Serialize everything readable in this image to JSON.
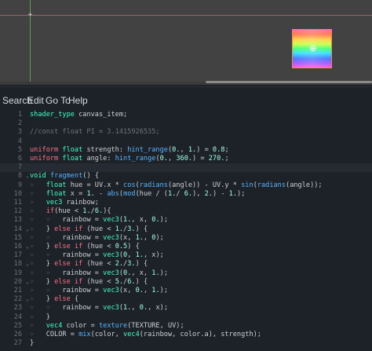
{
  "menu": [
    "Search",
    "Edit",
    "Go To",
    "Help"
  ],
  "viewport": {
    "pivot_glyph": "⊕",
    "origin_glyph": "+"
  },
  "editor": {
    "current_line": 7,
    "lines": [
      {
        "n": "1",
        "fold": "",
        "indent": 0,
        "tokens": [
          [
            "ty",
            "shader_type"
          ],
          [
            "nm",
            " canvas_item;"
          ]
        ]
      },
      {
        "n": "2",
        "fold": "",
        "indent": 0,
        "tokens": []
      },
      {
        "n": "3",
        "fold": "",
        "indent": 0,
        "tokens": [
          [
            "cm",
            "//const float PI = 3.1415926535;"
          ]
        ]
      },
      {
        "n": "4",
        "fold": "",
        "indent": 0,
        "tokens": []
      },
      {
        "n": "5",
        "fold": "",
        "indent": 0,
        "tokens": [
          [
            "kw",
            "uniform"
          ],
          [
            "nm",
            " "
          ],
          [
            "ty",
            "float"
          ],
          [
            "nm",
            " strength: "
          ],
          [
            "fn",
            "hint_range"
          ],
          [
            "nm",
            "("
          ],
          [
            "num",
            "0."
          ],
          [
            "nm",
            ", "
          ],
          [
            "num",
            "1."
          ],
          [
            "nm",
            ") = "
          ],
          [
            "num",
            "0.8"
          ],
          [
            "nm",
            ";"
          ]
        ]
      },
      {
        "n": "6",
        "fold": "",
        "indent": 0,
        "tokens": [
          [
            "kw",
            "uniform"
          ],
          [
            "nm",
            " "
          ],
          [
            "ty",
            "float"
          ],
          [
            "nm",
            " angle: "
          ],
          [
            "fn",
            "hint_range"
          ],
          [
            "nm",
            "("
          ],
          [
            "num",
            "0."
          ],
          [
            "nm",
            ", "
          ],
          [
            "num",
            "360."
          ],
          [
            "nm",
            ") = "
          ],
          [
            "num",
            "270."
          ],
          [
            "nm",
            ";"
          ]
        ]
      },
      {
        "n": "7",
        "fold": "",
        "indent": 0,
        "tokens": []
      },
      {
        "n": "8",
        "fold": "⌄",
        "indent": 0,
        "tokens": [
          [
            "ty",
            "void"
          ],
          [
            "nm",
            " "
          ],
          [
            "fn",
            "fragment"
          ],
          [
            "nm",
            "() {"
          ]
        ]
      },
      {
        "n": "9",
        "fold": "",
        "indent": 1,
        "tokens": [
          [
            "ty",
            "float"
          ],
          [
            "nm",
            " hue = UV.x * "
          ],
          [
            "fn",
            "cos"
          ],
          [
            "nm",
            "("
          ],
          [
            "fn",
            "radians"
          ],
          [
            "nm",
            "(angle)) - UV.y * "
          ],
          [
            "fn",
            "sin"
          ],
          [
            "nm",
            "("
          ],
          [
            "fn",
            "radians"
          ],
          [
            "nm",
            "(angle));"
          ]
        ]
      },
      {
        "n": "10",
        "fold": "",
        "indent": 1,
        "tokens": [
          [
            "ty",
            "float"
          ],
          [
            "nm",
            " x = "
          ],
          [
            "num",
            "1."
          ],
          [
            "nm",
            " - "
          ],
          [
            "fn",
            "abs"
          ],
          [
            "nm",
            "("
          ],
          [
            "fn",
            "mod"
          ],
          [
            "nm",
            "(hue / ("
          ],
          [
            "num",
            "1."
          ],
          [
            "nm",
            "/ "
          ],
          [
            "num",
            "6."
          ],
          [
            "nm",
            "), "
          ],
          [
            "num",
            "2."
          ],
          [
            "nm",
            ") - "
          ],
          [
            "num",
            "1."
          ],
          [
            "nm",
            ");"
          ]
        ]
      },
      {
        "n": "11",
        "fold": "",
        "indent": 1,
        "tokens": [
          [
            "ty",
            "vec3"
          ],
          [
            "nm",
            " rainbow;"
          ]
        ]
      },
      {
        "n": "12",
        "fold": "",
        "indent": 1,
        "tokens": [
          [
            "kw",
            "if"
          ],
          [
            "nm",
            "(hue < "
          ],
          [
            "num",
            "1."
          ],
          [
            "nm",
            "/"
          ],
          [
            "num",
            "6."
          ],
          [
            "nm",
            "){"
          ]
        ]
      },
      {
        "n": "13",
        "fold": "",
        "indent": 2,
        "tokens": [
          [
            "nm",
            "rainbow = "
          ],
          [
            "ty",
            "vec3"
          ],
          [
            "nm",
            "("
          ],
          [
            "num",
            "1."
          ],
          [
            "nm",
            ", x, "
          ],
          [
            "num",
            "0."
          ],
          [
            "nm",
            ");"
          ]
        ]
      },
      {
        "n": "14",
        "fold": "⌄",
        "indent": 1,
        "tokens": [
          [
            "nm",
            "} "
          ],
          [
            "kw",
            "else if"
          ],
          [
            "nm",
            " (hue < "
          ],
          [
            "num",
            "1."
          ],
          [
            "nm",
            "/"
          ],
          [
            "num",
            "3."
          ],
          [
            "nm",
            ") {"
          ]
        ]
      },
      {
        "n": "15",
        "fold": "",
        "indent": 2,
        "tokens": [
          [
            "nm",
            "rainbow = "
          ],
          [
            "ty",
            "vec3"
          ],
          [
            "nm",
            "(x, "
          ],
          [
            "num",
            "1."
          ],
          [
            "nm",
            ", "
          ],
          [
            "num",
            "0"
          ],
          [
            "nm",
            ");"
          ]
        ]
      },
      {
        "n": "16",
        "fold": "⌄",
        "indent": 1,
        "tokens": [
          [
            "nm",
            "} "
          ],
          [
            "kw",
            "else if"
          ],
          [
            "nm",
            " (hue < "
          ],
          [
            "num",
            "0.5"
          ],
          [
            "nm",
            ") {"
          ]
        ]
      },
      {
        "n": "17",
        "fold": "",
        "indent": 2,
        "tokens": [
          [
            "nm",
            "rainbow = "
          ],
          [
            "ty",
            "vec3"
          ],
          [
            "nm",
            "("
          ],
          [
            "num",
            "0"
          ],
          [
            "nm",
            ", "
          ],
          [
            "num",
            "1."
          ],
          [
            "nm",
            ", x);"
          ]
        ]
      },
      {
        "n": "18",
        "fold": "⌄",
        "indent": 1,
        "tokens": [
          [
            "nm",
            "} "
          ],
          [
            "kw",
            "else if"
          ],
          [
            "nm",
            " (hue < "
          ],
          [
            "num",
            "2."
          ],
          [
            "nm",
            "/"
          ],
          [
            "num",
            "3."
          ],
          [
            "nm",
            ") {"
          ]
        ]
      },
      {
        "n": "19",
        "fold": "",
        "indent": 2,
        "tokens": [
          [
            "nm",
            "rainbow = "
          ],
          [
            "ty",
            "vec3"
          ],
          [
            "nm",
            "("
          ],
          [
            "num",
            "0."
          ],
          [
            "nm",
            ", x, "
          ],
          [
            "num",
            "1."
          ],
          [
            "nm",
            ");"
          ]
        ]
      },
      {
        "n": "20",
        "fold": "⌄",
        "indent": 1,
        "tokens": [
          [
            "nm",
            "} "
          ],
          [
            "kw",
            "else if"
          ],
          [
            "nm",
            " (hue < "
          ],
          [
            "num",
            "5."
          ],
          [
            "nm",
            "/"
          ],
          [
            "num",
            "6."
          ],
          [
            "nm",
            ") {"
          ]
        ]
      },
      {
        "n": "21",
        "fold": "",
        "indent": 2,
        "tokens": [
          [
            "nm",
            "rainbow = "
          ],
          [
            "ty",
            "vec3"
          ],
          [
            "nm",
            "(x, "
          ],
          [
            "num",
            "0."
          ],
          [
            "nm",
            ", "
          ],
          [
            "num",
            "1."
          ],
          [
            "nm",
            ");"
          ]
        ]
      },
      {
        "n": "22",
        "fold": "⌄",
        "indent": 1,
        "tokens": [
          [
            "nm",
            "} "
          ],
          [
            "kw",
            "else"
          ],
          [
            "nm",
            " {"
          ]
        ]
      },
      {
        "n": "23",
        "fold": "",
        "indent": 2,
        "tokens": [
          [
            "nm",
            "rainbow = "
          ],
          [
            "ty",
            "vec3"
          ],
          [
            "nm",
            "("
          ],
          [
            "num",
            "1."
          ],
          [
            "nm",
            ", "
          ],
          [
            "num",
            "0."
          ],
          [
            "nm",
            ", x);"
          ]
        ]
      },
      {
        "n": "24",
        "fold": "",
        "indent": 1,
        "tokens": [
          [
            "nm",
            "}"
          ]
        ]
      },
      {
        "n": "25",
        "fold": "",
        "indent": 1,
        "tokens": [
          [
            "ty",
            "vec4"
          ],
          [
            "nm",
            " color = "
          ],
          [
            "fn",
            "texture"
          ],
          [
            "nm",
            "(TEXTURE, UV);"
          ]
        ]
      },
      {
        "n": "26",
        "fold": "",
        "indent": 1,
        "tokens": [
          [
            "nm",
            "COLOR = "
          ],
          [
            "fn",
            "mix"
          ],
          [
            "nm",
            "(color, "
          ],
          [
            "ty",
            "vec4"
          ],
          [
            "nm",
            "(rainbow, color.a), strength);"
          ]
        ]
      },
      {
        "n": "27",
        "fold": "",
        "indent": 0,
        "tokens": [
          [
            "nm",
            "}"
          ]
        ]
      }
    ]
  }
}
